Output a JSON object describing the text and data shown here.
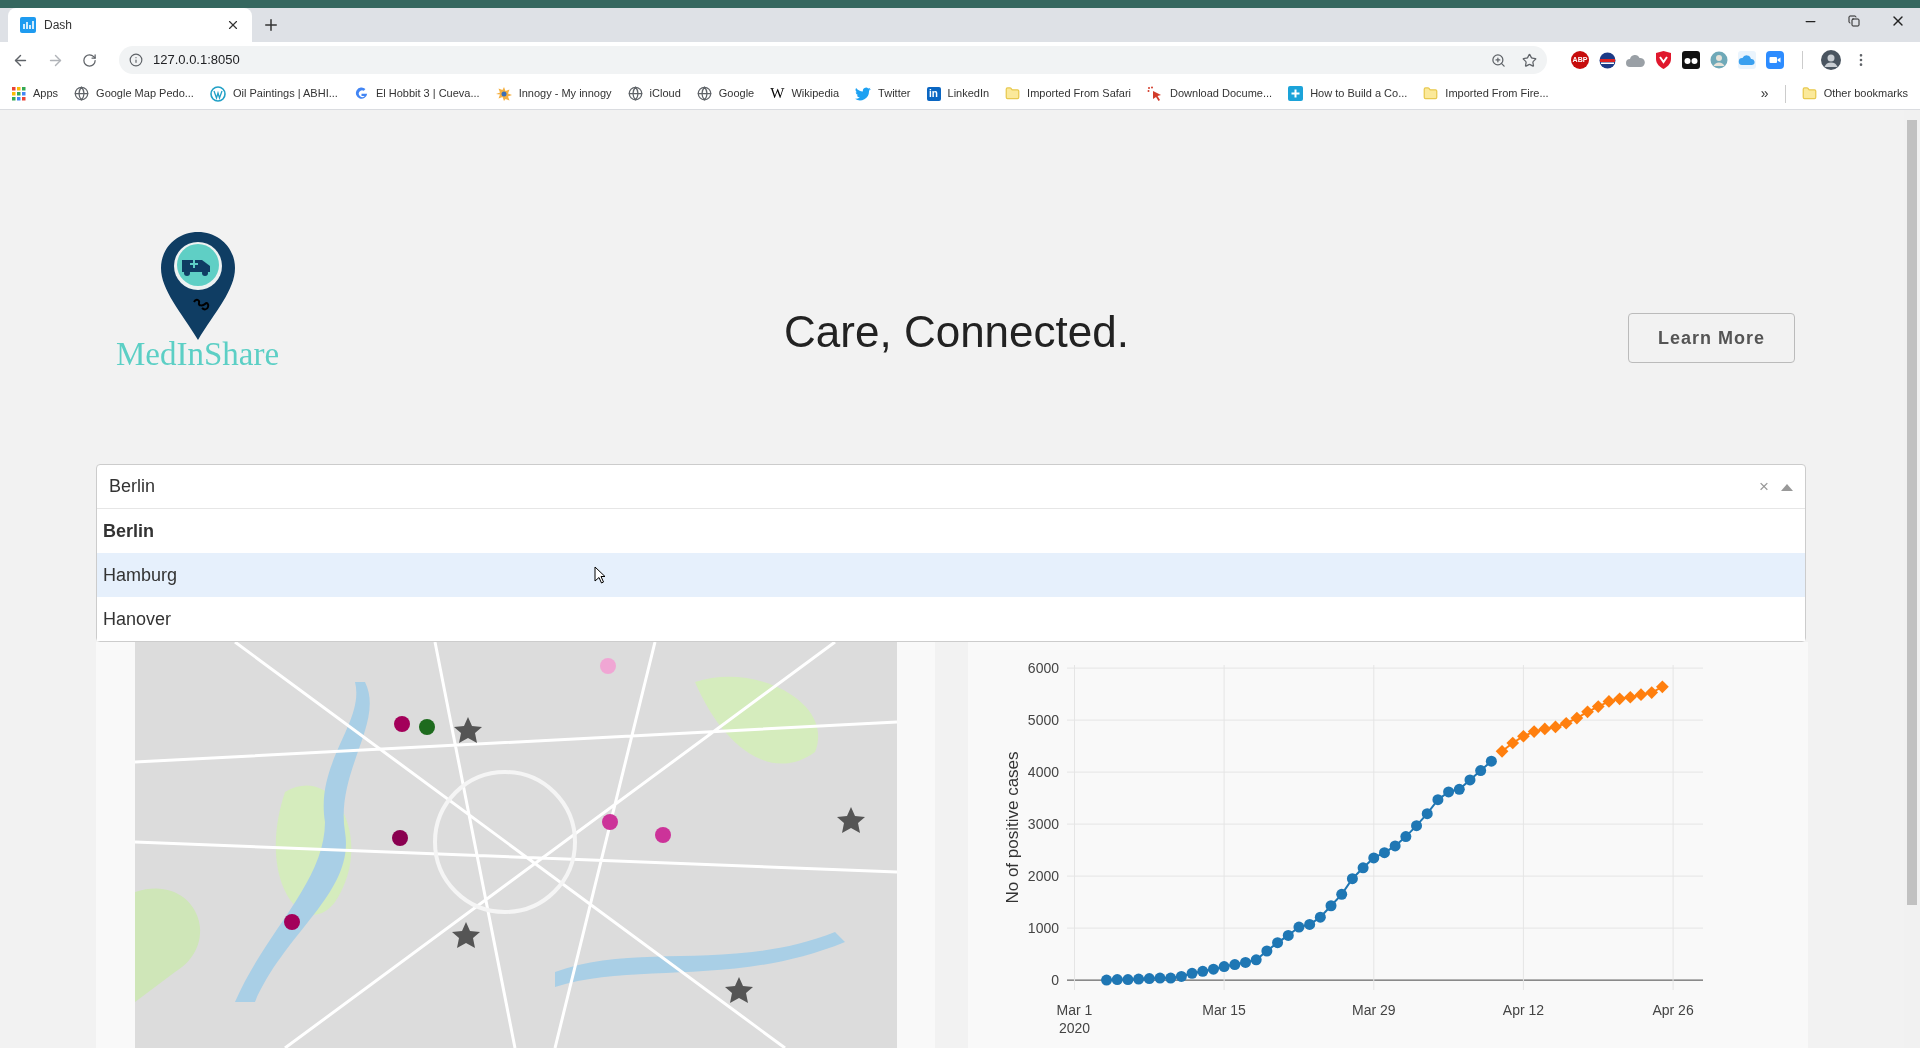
{
  "browser": {
    "tab": {
      "title": "Dash",
      "selected": true
    },
    "url": "127.0.0.1:8050",
    "bookmarks": [
      {
        "kind": "apps",
        "label": "Apps"
      },
      {
        "kind": "globe",
        "label": "Google Map Pedo..."
      },
      {
        "kind": "wordpress",
        "label": "Oil Paintings | ABHI..."
      },
      {
        "kind": "google",
        "label": "El Hobbit 3 | Cueva..."
      },
      {
        "kind": "sun",
        "label": "Innogy - My innogy"
      },
      {
        "kind": "globe",
        "label": "iCloud"
      },
      {
        "kind": "globe",
        "label": "Google"
      },
      {
        "kind": "wiki",
        "label": "Wikipedia",
        "glyph": "W"
      },
      {
        "kind": "bird",
        "label": "Twitter"
      },
      {
        "kind": "linkedin",
        "label": "LinkedIn",
        "glyph": "in"
      },
      {
        "kind": "folder",
        "label": "Imported From Safari"
      },
      {
        "kind": "pointer",
        "label": "Download Docume..."
      },
      {
        "kind": "plus",
        "label": "How to Build a Co..."
      },
      {
        "kind": "folder",
        "label": "Imported From Fire..."
      }
    ],
    "more_bookmarks": "»",
    "other_bookmarks": "Other bookmarks",
    "extensions": [
      {
        "kind": "stop",
        "label": "ABP"
      },
      {
        "kind": "flag"
      },
      {
        "kind": "cloud"
      },
      {
        "kind": "shield"
      },
      {
        "kind": "glasses"
      },
      {
        "kind": "avatar"
      },
      {
        "kind": "bluecloud"
      },
      {
        "kind": "video"
      }
    ]
  },
  "header": {
    "brand": "MedInShare",
    "tagline": "Care, Connected.",
    "button": "Learn More"
  },
  "city_select": {
    "value": "Berlin",
    "clear": "×",
    "expanded": true,
    "options": [
      {
        "label": "Berlin",
        "selected": true,
        "highlighted": false
      },
      {
        "label": "Hamburg",
        "selected": false,
        "highlighted": true
      },
      {
        "label": "Hanover",
        "selected": false,
        "highlighted": false
      }
    ]
  },
  "cases_chart": {
    "year_label": "2020",
    "chart_data": {
      "type": "line",
      "ylabel": "No of positive cases",
      "categories": [
        "Mar 1",
        null,
        null,
        null,
        null,
        null,
        null,
        null,
        null,
        null,
        null,
        null,
        null,
        null,
        "Mar 15",
        null,
        null,
        null,
        null,
        null,
        null,
        null,
        null,
        null,
        null,
        null,
        null,
        null,
        "Mar 29",
        null,
        null,
        null,
        null,
        null,
        null,
        null,
        null,
        null,
        null,
        null,
        null,
        null,
        "Apr 12",
        null,
        null,
        null,
        null,
        null,
        null,
        null,
        null,
        null,
        null,
        null,
        null,
        null,
        "Apr 26"
      ],
      "grid": true,
      "series": [
        {
          "color": "#1f77b4",
          "marker": "circle",
          "values": [
            null,
            null,
            null,
            0,
            10,
            10,
            20,
            30,
            40,
            40,
            70,
            130,
            170,
            210,
            260,
            300,
            340,
            390,
            560,
            720,
            860,
            1020,
            1070,
            1210,
            1430,
            1650,
            1950,
            2160,
            2350,
            2450,
            2580,
            2760,
            2970,
            3200,
            3470,
            3620,
            3670,
            3850,
            4030,
            4210,
            null,
            null,
            null,
            null,
            null,
            null,
            null,
            null,
            null,
            null,
            null,
            null,
            null,
            null,
            null,
            null,
            null
          ]
        },
        {
          "color": "#ff7f0e",
          "marker": "diamond",
          "values": [
            null,
            null,
            null,
            null,
            null,
            null,
            null,
            null,
            null,
            null,
            null,
            null,
            null,
            null,
            null,
            null,
            null,
            null,
            null,
            null,
            null,
            null,
            null,
            null,
            null,
            null,
            null,
            null,
            null,
            null,
            null,
            null,
            null,
            null,
            null,
            null,
            null,
            null,
            null,
            null,
            4400,
            4560,
            4690,
            4780,
            4830,
            4870,
            4940,
            5040,
            5160,
            5260,
            5360,
            5410,
            5440,
            5490,
            5530,
            5640,
            null
          ]
        }
      ],
      "ylim": [
        -190,
        6060
      ],
      "yticks": [
        0,
        1000,
        2000,
        3000,
        4000,
        5000,
        6000
      ]
    }
  }
}
